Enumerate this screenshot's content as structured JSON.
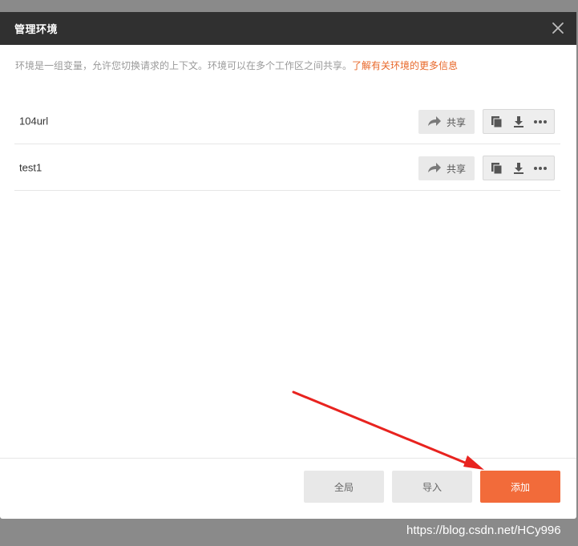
{
  "dialog": {
    "title": "管理环境",
    "intro_text": "环境是一组变量，允许您切换请求的上下文。环境可以在多个工作区之间共享。",
    "intro_link": "了解有关环境的更多信息"
  },
  "environments": [
    {
      "name": "104url",
      "share_label": "共享"
    },
    {
      "name": "test1",
      "share_label": "共享"
    }
  ],
  "footer": {
    "global_label": "全局",
    "import_label": "导入",
    "add_label": "添加"
  },
  "icons": {
    "close": "close-icon",
    "share": "share-arrow-icon",
    "duplicate": "copy-icon",
    "download": "download-icon",
    "more": "more-icon"
  },
  "colors": {
    "header_bg": "#303030",
    "accent": "#f26b3a",
    "link": "#e8682a",
    "annotation_arrow": "#e8231f"
  },
  "watermark": "https://blog.csdn.net/HCy996"
}
